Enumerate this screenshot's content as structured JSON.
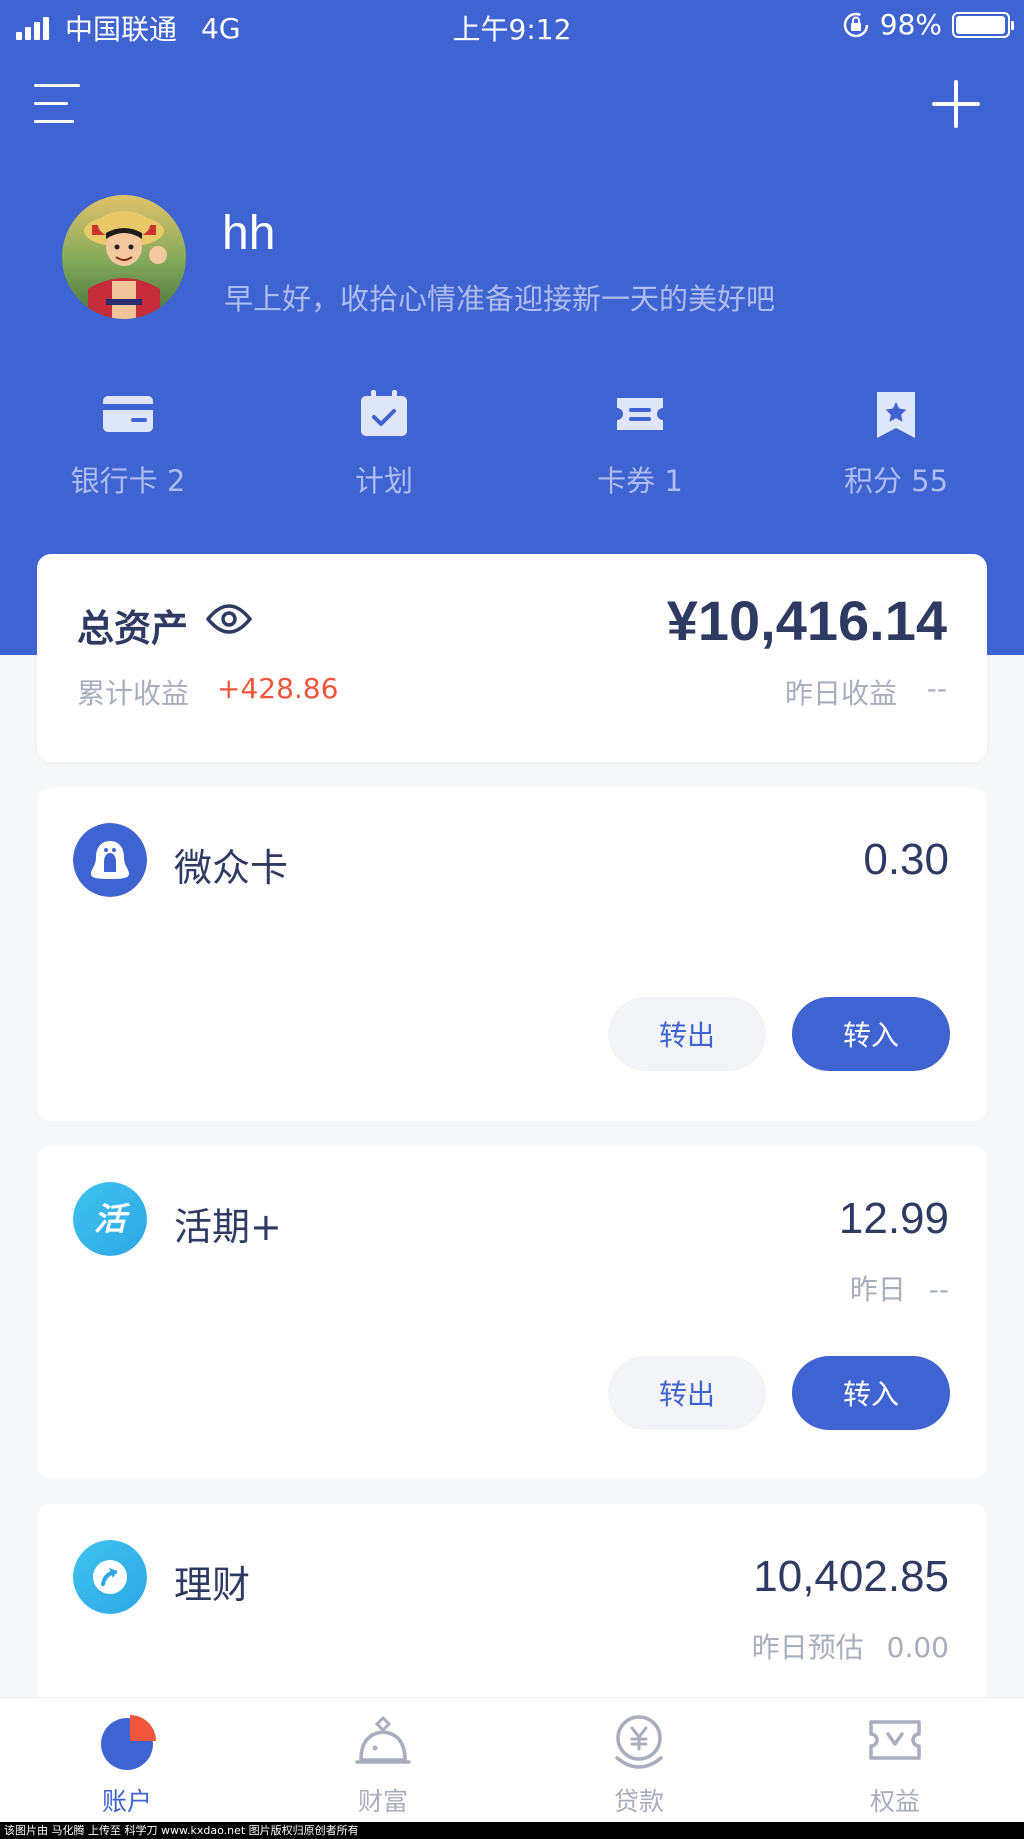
{
  "status_bar": {
    "carrier": "中国联通",
    "network": "4G",
    "time": "上午9:12",
    "battery_percent": "98%",
    "battery_level": 0.98
  },
  "header": {
    "menu_icon": "hamburger-menu-icon",
    "add_icon": "plus-icon"
  },
  "profile": {
    "username": "hh",
    "greeting": "早上好，收拾心情准备迎接新一天的美好吧",
    "avatar": "avatar-image"
  },
  "quick_links": [
    {
      "label": "银行卡 2",
      "icon": "bank-card-icon"
    },
    {
      "label": "计划",
      "icon": "calendar-check-icon"
    },
    {
      "label": "卡券 1",
      "icon": "ticket-icon"
    },
    {
      "label": "积分 55",
      "icon": "bookmark-star-icon"
    }
  ],
  "assets": {
    "title": "总资产",
    "eye_icon": "eye-icon",
    "total": "¥10,416.14",
    "cumulative_label": "累计收益",
    "cumulative_value": "+428.86",
    "yesterday_label": "昨日收益",
    "yesterday_value": "--"
  },
  "accounts": [
    {
      "name": "微众卡",
      "amount": "0.30",
      "icon": "penguin-icon",
      "out_label": "转出",
      "in_label": "转入"
    },
    {
      "name": "活期+",
      "amount": "12.99",
      "sub_label": "昨日",
      "sub_value": "--",
      "icon": "huo-icon",
      "icon_text": "活",
      "out_label": "转出",
      "in_label": "转入"
    },
    {
      "name": "理财",
      "amount": "10,402.85",
      "sub_label": "昨日预估",
      "sub_value": "0.00",
      "icon": "wealth-arrow-icon"
    }
  ],
  "tabbar": [
    {
      "label": "账户",
      "icon": "pie-chart-icon",
      "active": true
    },
    {
      "label": "财富",
      "icon": "piggy-bank-icon",
      "active": false
    },
    {
      "label": "贷款",
      "icon": "yuan-coin-icon",
      "active": false
    },
    {
      "label": "权益",
      "icon": "voucher-icon",
      "active": false
    }
  ],
  "footer_text": "该图片由 马化腾 上传至 科学刀 www.kxdao.net 图片版权归原创者所有",
  "colors": {
    "primary": "#3f63d0",
    "text_dark": "#2f3a63",
    "text_gray": "#a9aebf",
    "positive_red": "#f0563d",
    "background": "#f7f8fa"
  }
}
